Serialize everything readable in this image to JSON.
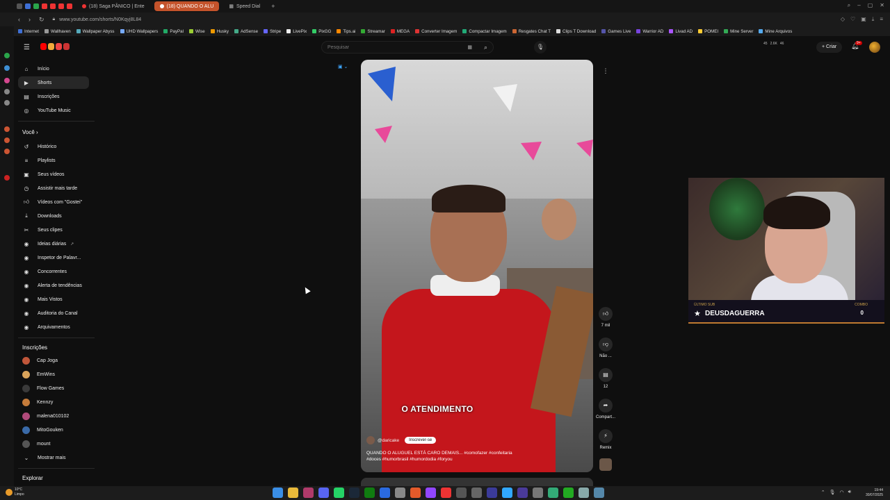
{
  "browser": {
    "tabs": [
      {
        "label": "(18) Saga PÂNICO | Ente"
      },
      {
        "label": "(18) QUANDO O ALU",
        "active": true
      },
      {
        "label": "Speed Dial"
      }
    ],
    "url": "www.youtube.com/shorts/N0Kqyj8L84",
    "bookmarks": [
      "Internet",
      "Wallhaven",
      "Wallpaper Abyss",
      "UHD Wallpapers",
      "PayPal",
      "Wise",
      "Husky",
      "AdSense",
      "Stripe",
      "LivePix",
      "PixGG",
      "Tips.ai",
      "Streamar",
      "MEGA",
      "Converter Imagem",
      "Compactar Imagem",
      "Resgates Chat T",
      "Clips T Download",
      "Games Live",
      "Warrior AD",
      "Livad AD",
      "POMEI",
      "Mine Server",
      "Mine Arquivos"
    ]
  },
  "header": {
    "search_placeholder": "Pesquisar",
    "create_label": "Criar",
    "notifications_badge": "9+",
    "stats": [
      "45",
      "2.6K",
      "46"
    ]
  },
  "nav": {
    "main": [
      {
        "label": "Início",
        "icon": "home-icon"
      },
      {
        "label": "Shorts",
        "icon": "shorts-icon",
        "active": true
      },
      {
        "label": "Inscrições",
        "icon": "subscriptions-icon"
      },
      {
        "label": "YouTube Music",
        "icon": "music-icon"
      }
    ],
    "you_heading": "Você",
    "you": [
      {
        "label": "Histórico",
        "icon": "history-icon"
      },
      {
        "label": "Playlists",
        "icon": "playlist-icon"
      },
      {
        "label": "Seus vídeos",
        "icon": "video-icon"
      },
      {
        "label": "Assistir mais tarde",
        "icon": "clock-icon"
      },
      {
        "label": "Vídeos com \"Gostei\"",
        "icon": "like-icon"
      },
      {
        "label": "Downloads",
        "icon": "download-icon"
      },
      {
        "label": "Seus clipes",
        "icon": "scissors-icon"
      },
      {
        "label": "Ideias diárias",
        "icon": "bulb-icon"
      },
      {
        "label": "Inspetor de Palavr...",
        "icon": "inspector-icon"
      },
      {
        "label": "Concorrentes",
        "icon": "competitors-icon"
      },
      {
        "label": "Alerta de tendências",
        "icon": "trend-icon"
      },
      {
        "label": "Mais Vistos",
        "icon": "eye-icon"
      },
      {
        "label": "Auditoria do Canal",
        "icon": "audit-icon"
      },
      {
        "label": "Arquivamentos",
        "icon": "archive-icon"
      }
    ],
    "subs_heading": "Inscrições",
    "subs": [
      {
        "label": "Cap Joga",
        "color": "#c0563a"
      },
      {
        "label": "EmWins",
        "color": "#d9a35a"
      },
      {
        "label": "Flow Games",
        "color": "#3a3a3a"
      },
      {
        "label": "Kennzy",
        "color": "#c47b3a"
      },
      {
        "label": "malena010102",
        "color": "#b04a7a"
      },
      {
        "label": "MitoGouken",
        "color": "#3a6aa8"
      },
      {
        "label": "mount",
        "color": "#555555"
      }
    ],
    "show_more": "Mostrar mais",
    "explore_heading": "Explorar"
  },
  "short": {
    "overlay_text": "O ATENDIMENTO",
    "channel": "@daricake",
    "subscribe_label": "Inscrever-se",
    "description": "QUANDO O ALUGUEL ESTÁ CARO DEMAIS... #comofazer #confeitaria #doces #humorbrasil #humordodia #foryou",
    "actions": [
      {
        "icon": "like-icon",
        "label": "7 mil"
      },
      {
        "icon": "dislike-icon",
        "label": "Não ..."
      },
      {
        "icon": "comment-icon",
        "label": "12"
      },
      {
        "icon": "share-icon",
        "label": "Compart..."
      },
      {
        "icon": "remix-icon",
        "label": "Remix"
      }
    ]
  },
  "stream_overlay": {
    "last_sub_label": "ÚLTIMO SUB",
    "last_sub_name": "DEUSDAGUERRA",
    "combo_label": "COMBO",
    "combo_value": "0"
  },
  "taskbar": {
    "weather_temp": "10°C",
    "weather_desc": "Limpo",
    "time": "19:44",
    "date": "30/07/2025"
  },
  "colors": {
    "background": "#0f0f0f",
    "accent_red": "#ff0000",
    "link_blue": "#3ea6ff",
    "active_tab": "#c4532b"
  }
}
